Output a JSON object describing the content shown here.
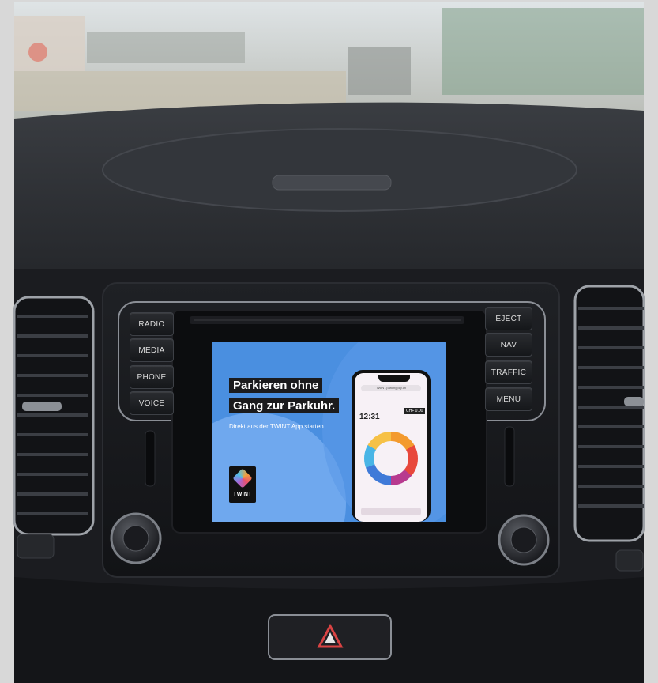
{
  "scene": {
    "description_colors": {
      "dashboard": "#2a2c31",
      "screen_bg": "#4a8fe0",
      "bezel": "#111214"
    }
  },
  "left_buttons": [
    {
      "label": "RADIO"
    },
    {
      "label": "MEDIA"
    },
    {
      "label": "PHONE"
    },
    {
      "label": "VOICE"
    }
  ],
  "right_buttons": [
    {
      "label": "EJECT"
    },
    {
      "label": "NAV"
    },
    {
      "label": "TRAFFIC"
    },
    {
      "label": "MENU"
    }
  ],
  "screen": {
    "headline_1": "Parkieren ohne",
    "headline_2": "Gang zur Parkuhr.",
    "subline": "Direkt aus der TWINT App starten.",
    "logo_text": "TWINT",
    "phone": {
      "url": "TWINT.parkingpay.ch",
      "time": "12:31",
      "price": "CHF 0.00"
    }
  },
  "icons": {
    "left_knob": "volume-knob-icon",
    "right_knob": "tune-knob-icon",
    "hazard": "hazard-triangle-icon"
  }
}
